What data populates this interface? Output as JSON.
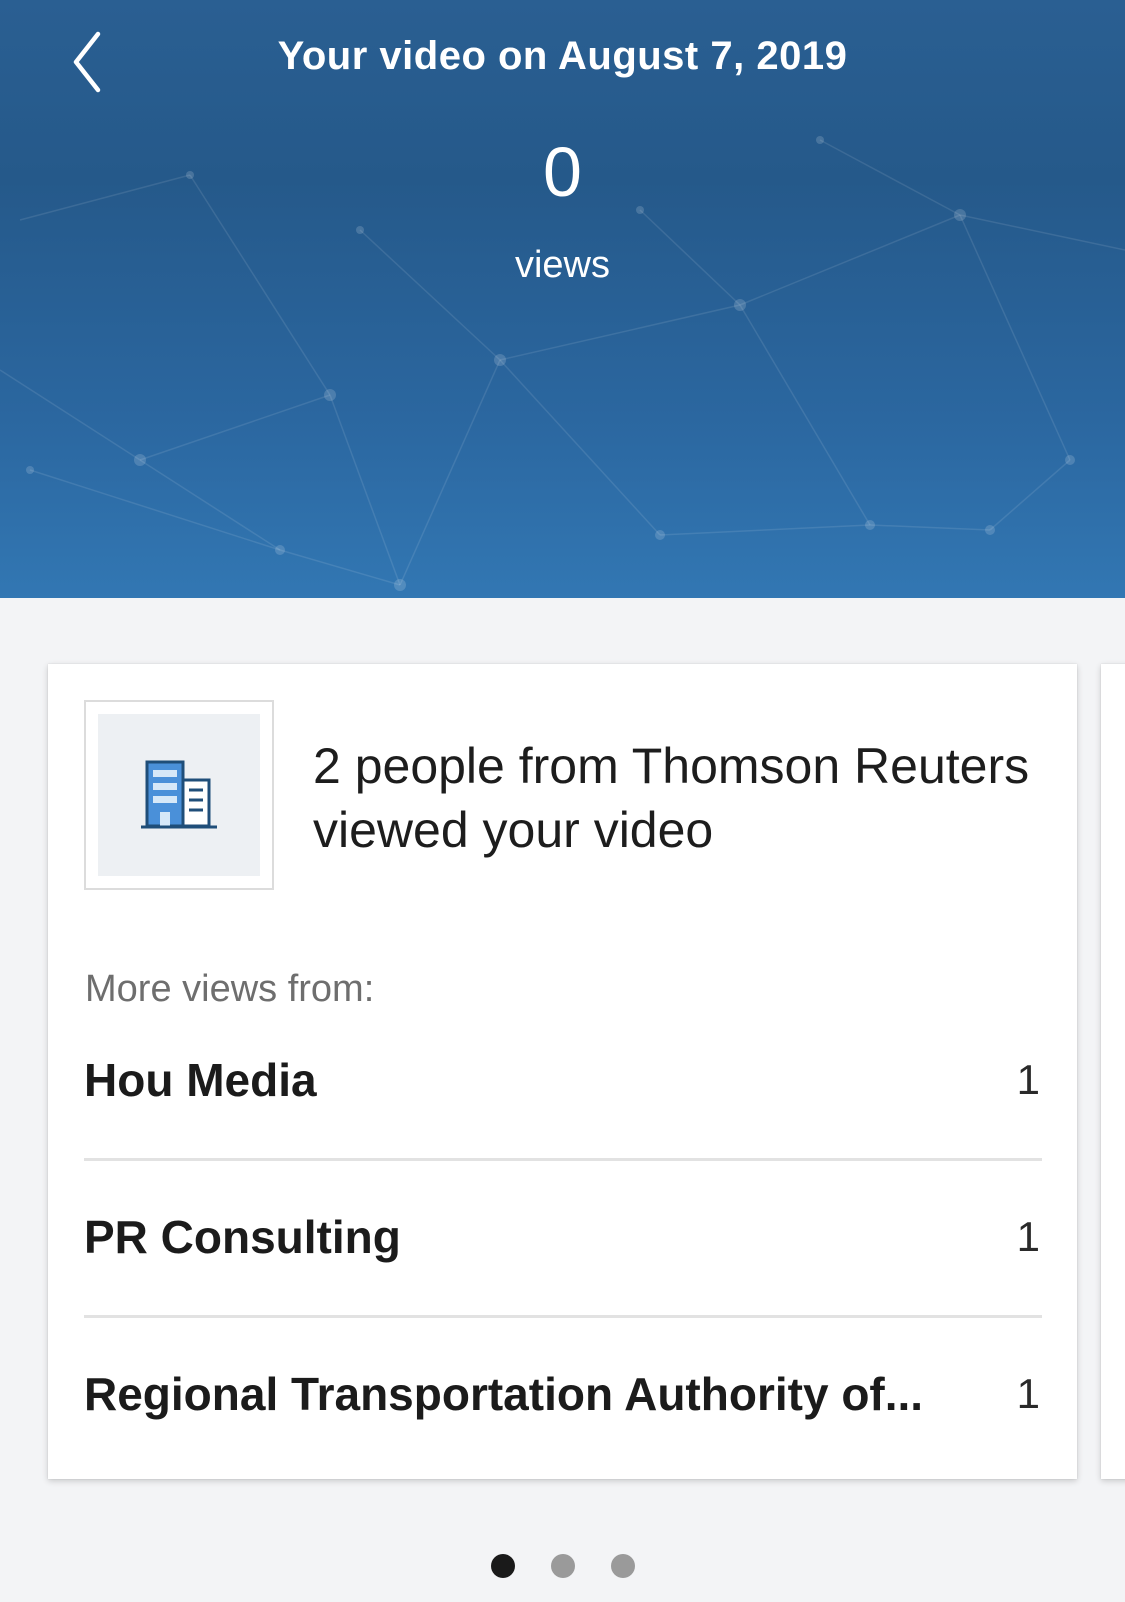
{
  "header": {
    "title": "Your video on August 7, 2019",
    "views_count": "0",
    "views_label": "views",
    "colors": {
      "top": "#2a5f92",
      "bottom": "#3277b3"
    }
  },
  "card": {
    "logo_icon": "building-icon",
    "headline": "2 people from Thomson Reuters viewed your video",
    "more_label": "More views from:",
    "rows": [
      {
        "name": "Hou Media",
        "count": "1"
      },
      {
        "name": "PR Consulting",
        "count": "1"
      },
      {
        "name": "Regional Transportation Authority of...",
        "count": "1"
      }
    ]
  },
  "pagination": {
    "total": 3,
    "active_index": 0
  },
  "icons": {
    "back": "chevron-left-icon"
  }
}
